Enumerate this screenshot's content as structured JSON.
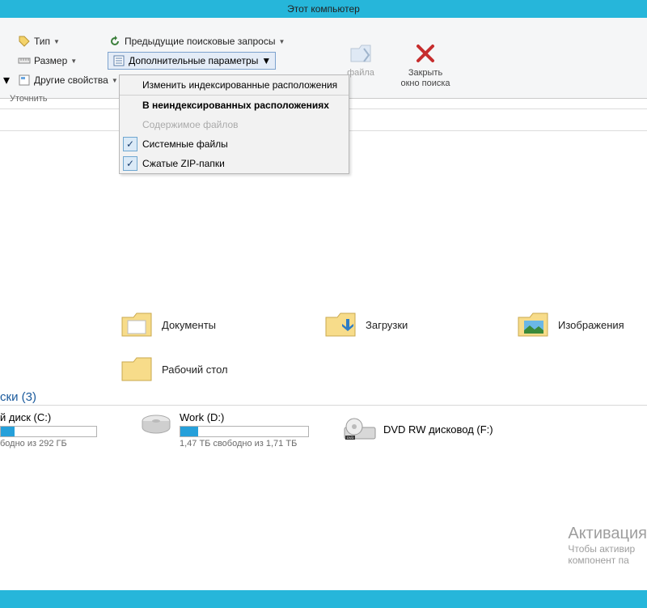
{
  "title": "Этот компьютер",
  "ribbon": {
    "type_label": "Тип",
    "size_label": "Размер",
    "other_props_label": "Другие свойства",
    "refine_label": "Уточнить",
    "prev_queries_label": "Предыдущие поисковые запросы",
    "adv_params_label": "Дополнительные параметры",
    "open_location_label": "файла",
    "close_search_line1": "Закрыть",
    "close_search_line2": "окно поиска"
  },
  "dropdown": {
    "change_indexed": "Изменить индексированные расположения",
    "non_indexed_header": "В неиндексированных расположениях",
    "file_contents": "Содержимое файлов",
    "system_files": "Системные файлы",
    "zip_folders": "Сжатые ZIP-папки"
  },
  "folders": {
    "documents": "Документы",
    "downloads": "Загрузки",
    "pictures": "Изображения",
    "desktop": "Рабочий стол"
  },
  "drives_section": "ски (3)",
  "drives": {
    "c_name": "й диск (C:)",
    "c_free": "бодно из 292 ГБ",
    "c_fill_pct": 14,
    "d_name": "Work (D:)",
    "d_free": "1,47 ТБ свободно из 1,71 ТБ",
    "d_fill_pct": 14,
    "f_name": "DVD RW дисковод (F:)"
  },
  "watermark": {
    "line1": "Активация",
    "line2": "Чтобы активир",
    "line3": "компонент па"
  }
}
